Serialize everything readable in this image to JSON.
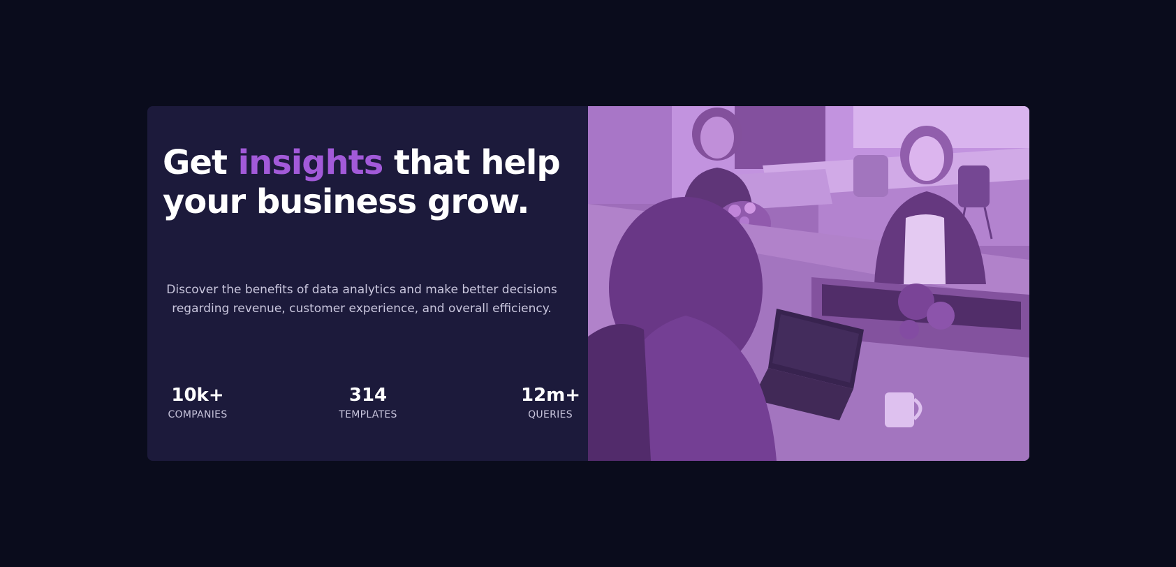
{
  "hero": {
    "headline_before": "Get ",
    "headline_accent": "insights",
    "headline_after": " that help your business grow.",
    "description": "Discover the benefits of data analytics and make better decisions regarding revenue, customer experience, and overall efficiency.",
    "stats": [
      {
        "value": "10k+",
        "label": "COMPANIES"
      },
      {
        "value": "314",
        "label": "TEMPLATES"
      },
      {
        "value": "12m+",
        "label": "QUERIES"
      }
    ]
  },
  "colors": {
    "page_background": "#0a0c1c",
    "card_background": "#1c1a3b",
    "accent": "#a25ad9",
    "heading": "#ffffff",
    "body_text": "#c9c6dd",
    "image_overlay": "#aa5cdb"
  },
  "image": {
    "subject": "three women working at laptops around an office table"
  }
}
